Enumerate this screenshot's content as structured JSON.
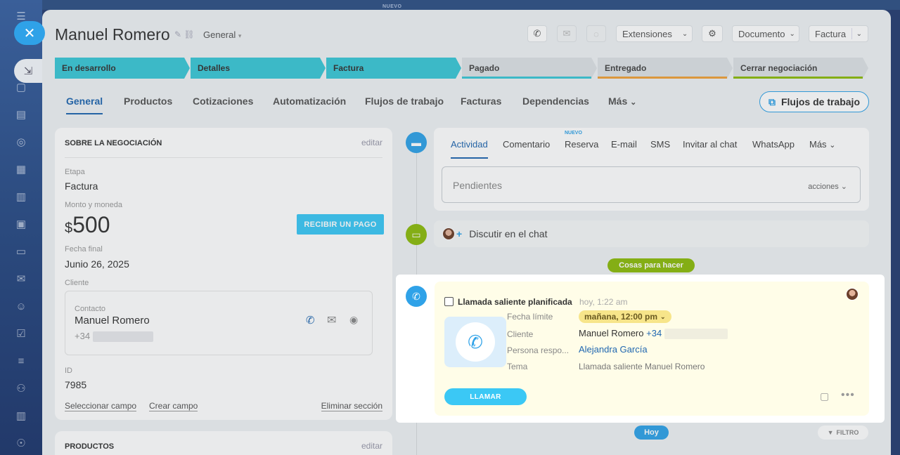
{
  "topbar": {
    "new_label": "NUEVO"
  },
  "deal": {
    "title": "Manuel Romero",
    "category": "General"
  },
  "header": {
    "extensions": "Extensiones",
    "document": "Documento",
    "invoice": "Factura"
  },
  "stages": [
    {
      "label": "En desarrollo",
      "state": "active",
      "color": "#3bc8d6"
    },
    {
      "label": "Detalles",
      "state": "active",
      "color": "#3bc8d6"
    },
    {
      "label": "Factura",
      "state": "active",
      "color": "#3bc8d6"
    },
    {
      "label": "Pagado",
      "state": "pending",
      "color": "#3bc8d6"
    },
    {
      "label": "Entregado",
      "state": "pending",
      "color": "#f0a13a"
    },
    {
      "label": "Cerrar negociación",
      "state": "pending",
      "color": "#8dbb0c"
    }
  ],
  "tabs": {
    "general": "General",
    "products": "Productos",
    "quotes": "Cotizaciones",
    "automation": "Automatización",
    "workflows": "Flujos de trabajo",
    "invoices": "Facturas",
    "dependencies": "Dependencias",
    "more": "Más"
  },
  "flows_button": "Flujos de trabajo",
  "about": {
    "title": "SOBRE LA NEGOCIACIÓN",
    "edit": "editar",
    "stage_label": "Etapa",
    "stage_value": "Factura",
    "amount_label": "Monto y moneda",
    "currency": "$",
    "amount": "500",
    "pay_button": "RECIBIR UN PAGO",
    "close_label": "Fecha final",
    "close_value": "Junio 26, 2025",
    "client_label": "Cliente",
    "contact_label": "Contacto",
    "contact_name": "Manuel Romero",
    "contact_phone": "+34",
    "id_label": "ID",
    "id_value": "7985",
    "select_field": "Seleccionar campo",
    "create_field": "Crear campo",
    "delete_section": "Eliminar sección"
  },
  "products_card": {
    "title": "PRODUCTOS",
    "edit": "editar"
  },
  "editor": {
    "tabs": [
      "Actividad",
      "Comentario",
      "Reserva",
      "E-mail",
      "SMS",
      "Invitar al chat",
      "WhatsApp",
      "Más"
    ],
    "new_badge": "NUEVO",
    "pending_placeholder": "Pendientes",
    "actions": "acciones"
  },
  "chat": {
    "label": "Discutir en el chat"
  },
  "todo_pill": "Cosas para hacer",
  "activity": {
    "title": "Llamada saliente planificada",
    "time": "hoy, 1:22 am",
    "deadline_label": "Fecha límite",
    "deadline_value": "mañana, 12:00 pm",
    "client_label": "Cliente",
    "client_name": "Manuel Romero",
    "client_phone": "+34",
    "responsible_label": "Persona respo...",
    "responsible_value": "Alejandra García",
    "subject_label": "Tema",
    "subject_value": "Llamada saliente Manuel Romero",
    "call_button": "LLAMAR"
  },
  "today_pill": "Hoy",
  "filter": "FILTRO",
  "colors": {
    "accent": "#2fa2e8",
    "stage_active": "#3bc8d6",
    "link": "#2067b0",
    "todo": "#8dbb0c"
  }
}
